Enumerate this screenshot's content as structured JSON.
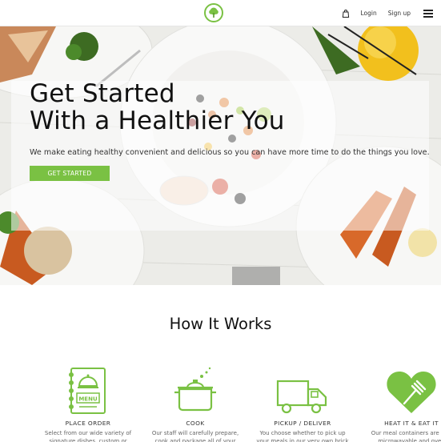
{
  "nav": {
    "login_label": "Login",
    "signup_label": "Sign up",
    "bag_icon": "shopping-bag-icon",
    "menu_icon": "hamburger-menu-icon",
    "logo_icon": "tree-logo-icon"
  },
  "hero": {
    "title_line1": "Get Started",
    "title_line2": "With a Healthier You",
    "subtitle": "We make eating healthy convenient and delicious so you can have more time to do the things you love.",
    "cta_label": "GET STARTED"
  },
  "how": {
    "title": "How It Works",
    "steps": [
      {
        "title": "PLACE ORDER",
        "icon": "menu-card-icon",
        "desc": "Select from our wide variety of signature dishes, custom or"
      },
      {
        "title": "COOK",
        "icon": "cooking-pot-icon",
        "desc": "Our staff will carefully prepare, cook and package all of your"
      },
      {
        "title": "PICKUP / DELIVER",
        "icon": "delivery-truck-icon",
        "desc": "You choose whether to pick up your meals in our very own brick"
      },
      {
        "title": "HEAT IT & EAT IT",
        "icon": "heart-fork-icon",
        "desc": "Our meal containers are BPA microwavable and oven"
      }
    ]
  },
  "colors": {
    "accent": "#7ac143",
    "text_dark": "#111111"
  }
}
